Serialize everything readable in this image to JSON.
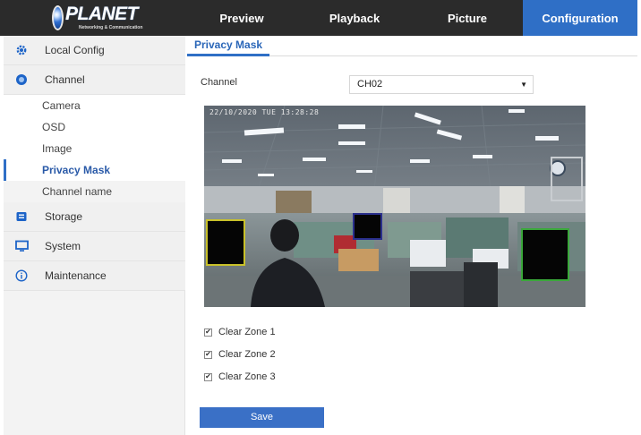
{
  "header": {
    "logo_text": "PLANET",
    "logo_subtext": "Networking & Communication",
    "tabs": [
      {
        "label": "Preview"
      },
      {
        "label": "Playback"
      },
      {
        "label": "Picture"
      },
      {
        "label": "Configuration",
        "active": true
      }
    ]
  },
  "sidebar": {
    "items": [
      {
        "label": "Local Config",
        "icon": "local-config-icon"
      },
      {
        "label": "Channel",
        "icon": "channel-icon"
      },
      {
        "label": "Storage",
        "icon": "storage-icon"
      },
      {
        "label": "System",
        "icon": "monitor-icon"
      },
      {
        "label": "Maintenance",
        "icon": "info-icon"
      }
    ],
    "channel_sub": [
      {
        "label": "Camera"
      },
      {
        "label": "OSD"
      },
      {
        "label": "Image"
      },
      {
        "label": "Privacy Mask",
        "active": true
      },
      {
        "label": "Channel name"
      }
    ]
  },
  "main": {
    "title": "Privacy Mask",
    "channel_label": "Channel",
    "channel_value": "CH02",
    "osd_timestamp": "22/10/2020 TUE 13:28:28",
    "checkboxes": [
      {
        "label": "Clear Zone 1",
        "checked": true
      },
      {
        "label": "Clear Zone 2",
        "checked": true
      },
      {
        "label": "Clear Zone 3",
        "checked": true
      }
    ],
    "save_label": "Save"
  },
  "colors": {
    "accent": "#2f6fc6",
    "topbar": "#2b2b2b",
    "mask_border_1": "#c9c12a",
    "mask_border_2": "#2a2f8c",
    "mask_border_3": "#3aa83a"
  }
}
